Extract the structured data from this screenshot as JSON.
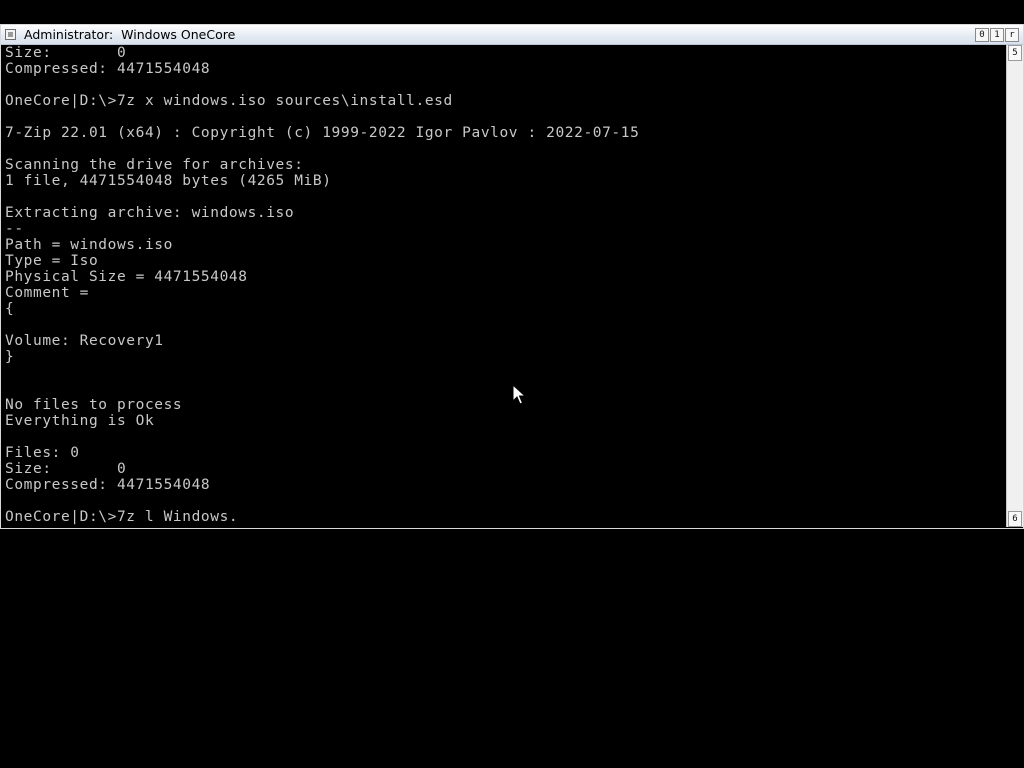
{
  "window": {
    "title": "Administrator:  Windows OneCore",
    "buttons": {
      "minimize": "0",
      "maximize": "1",
      "close": "r"
    }
  },
  "scrollbar": {
    "up_glyph": "5",
    "down_glyph": "6"
  },
  "console": {
    "lines": [
      "Size:       0",
      "Compressed: 4471554048",
      "",
      "OneCore|D:\\>7z x windows.iso sources\\install.esd",
      "",
      "7-Zip 22.01 (x64) : Copyright (c) 1999-2022 Igor Pavlov : 2022-07-15",
      "",
      "Scanning the drive for archives:",
      "1 file, 4471554048 bytes (4265 MiB)",
      "",
      "Extracting archive: windows.iso",
      "--",
      "Path = windows.iso",
      "Type = Iso",
      "Physical Size = 4471554048",
      "Comment =",
      "{",
      "",
      "Volume: Recovery1",
      "}",
      "",
      "",
      "No files to process",
      "Everything is Ok",
      "",
      "Files: 0",
      "Size:       0",
      "Compressed: 4471554048",
      "",
      "OneCore|D:\\>7z l Windows."
    ]
  }
}
